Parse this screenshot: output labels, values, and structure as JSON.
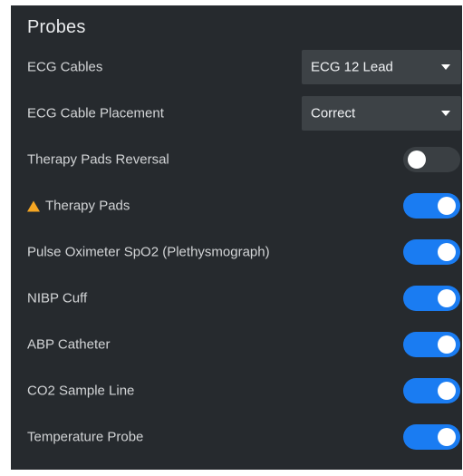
{
  "panel": {
    "title": "Probes"
  },
  "rows": [
    {
      "label": "ECG Cables",
      "control": "select",
      "value": "ECG 12 Lead"
    },
    {
      "label": "ECG Cable Placement",
      "control": "select",
      "value": "Correct"
    },
    {
      "label": "Therapy Pads Reversal",
      "control": "toggle",
      "on": false
    },
    {
      "label": "Therapy Pads",
      "control": "toggle",
      "on": true,
      "icon": "warning-triangle-icon"
    },
    {
      "label": "Pulse Oximeter SpO2 (Plethysmograph)",
      "control": "toggle",
      "on": true
    },
    {
      "label": "NIBP Cuff",
      "control": "toggle",
      "on": true
    },
    {
      "label": "ABP Catheter",
      "control": "toggle",
      "on": true
    },
    {
      "label": "CO2 Sample Line",
      "control": "toggle",
      "on": true
    },
    {
      "label": "Temperature Probe",
      "control": "toggle",
      "on": true
    }
  ],
  "colors": {
    "panel_bg": "#262a2e",
    "toggle_on": "#1a7cf2",
    "toggle_off": "#3a3f43",
    "warning": "#f5a623",
    "select_bg": "#3d4246"
  }
}
